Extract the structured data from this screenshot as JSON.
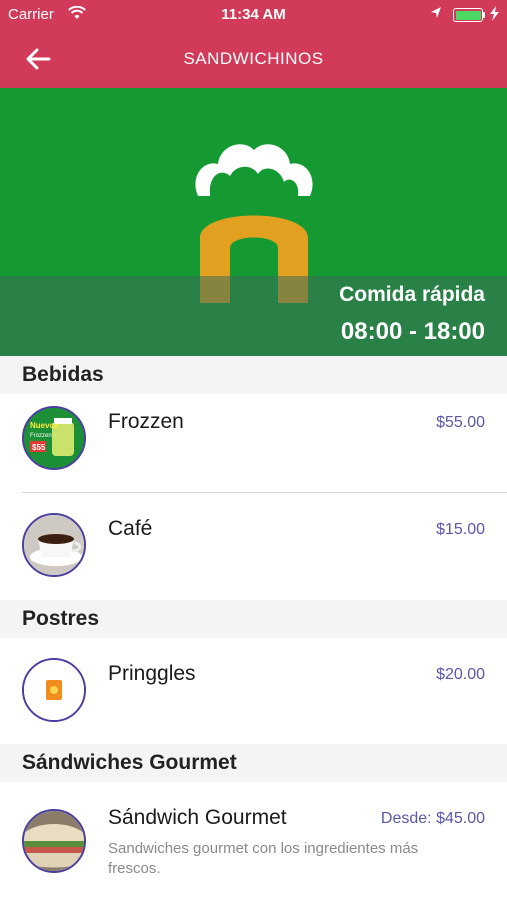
{
  "status_bar": {
    "carrier": "Carrier",
    "time": "11:34 AM",
    "battery_color": "#4cd964"
  },
  "nav": {
    "title": "SANDWICHINOS",
    "back_icon": "arrow-left-icon"
  },
  "hero": {
    "category": "Comida rápida",
    "hours": "08:00 - 18:00",
    "background_color": "#159a33"
  },
  "sections": [
    {
      "title": "Bebidas",
      "items": [
        {
          "name": "Frozzen",
          "price": "$55.00",
          "thumb_text_1": "Nuevos",
          "thumb_text_2": "Frozzen",
          "thumb_text_3": "$55"
        },
        {
          "name": "Café",
          "price": "$15.00"
        }
      ]
    },
    {
      "title": "Postres",
      "items": [
        {
          "name": "Pringgles",
          "price": "$20.00"
        }
      ]
    },
    {
      "title": "Sándwiches Gourmet",
      "items": [
        {
          "name": "Sándwich Gourmet",
          "price": "Desde: $45.00",
          "description": "Sandwiches gourmet con los ingredientes más frescos."
        }
      ]
    }
  ],
  "colors": {
    "primary": "#d23a5a",
    "price": "#5a57a8"
  }
}
